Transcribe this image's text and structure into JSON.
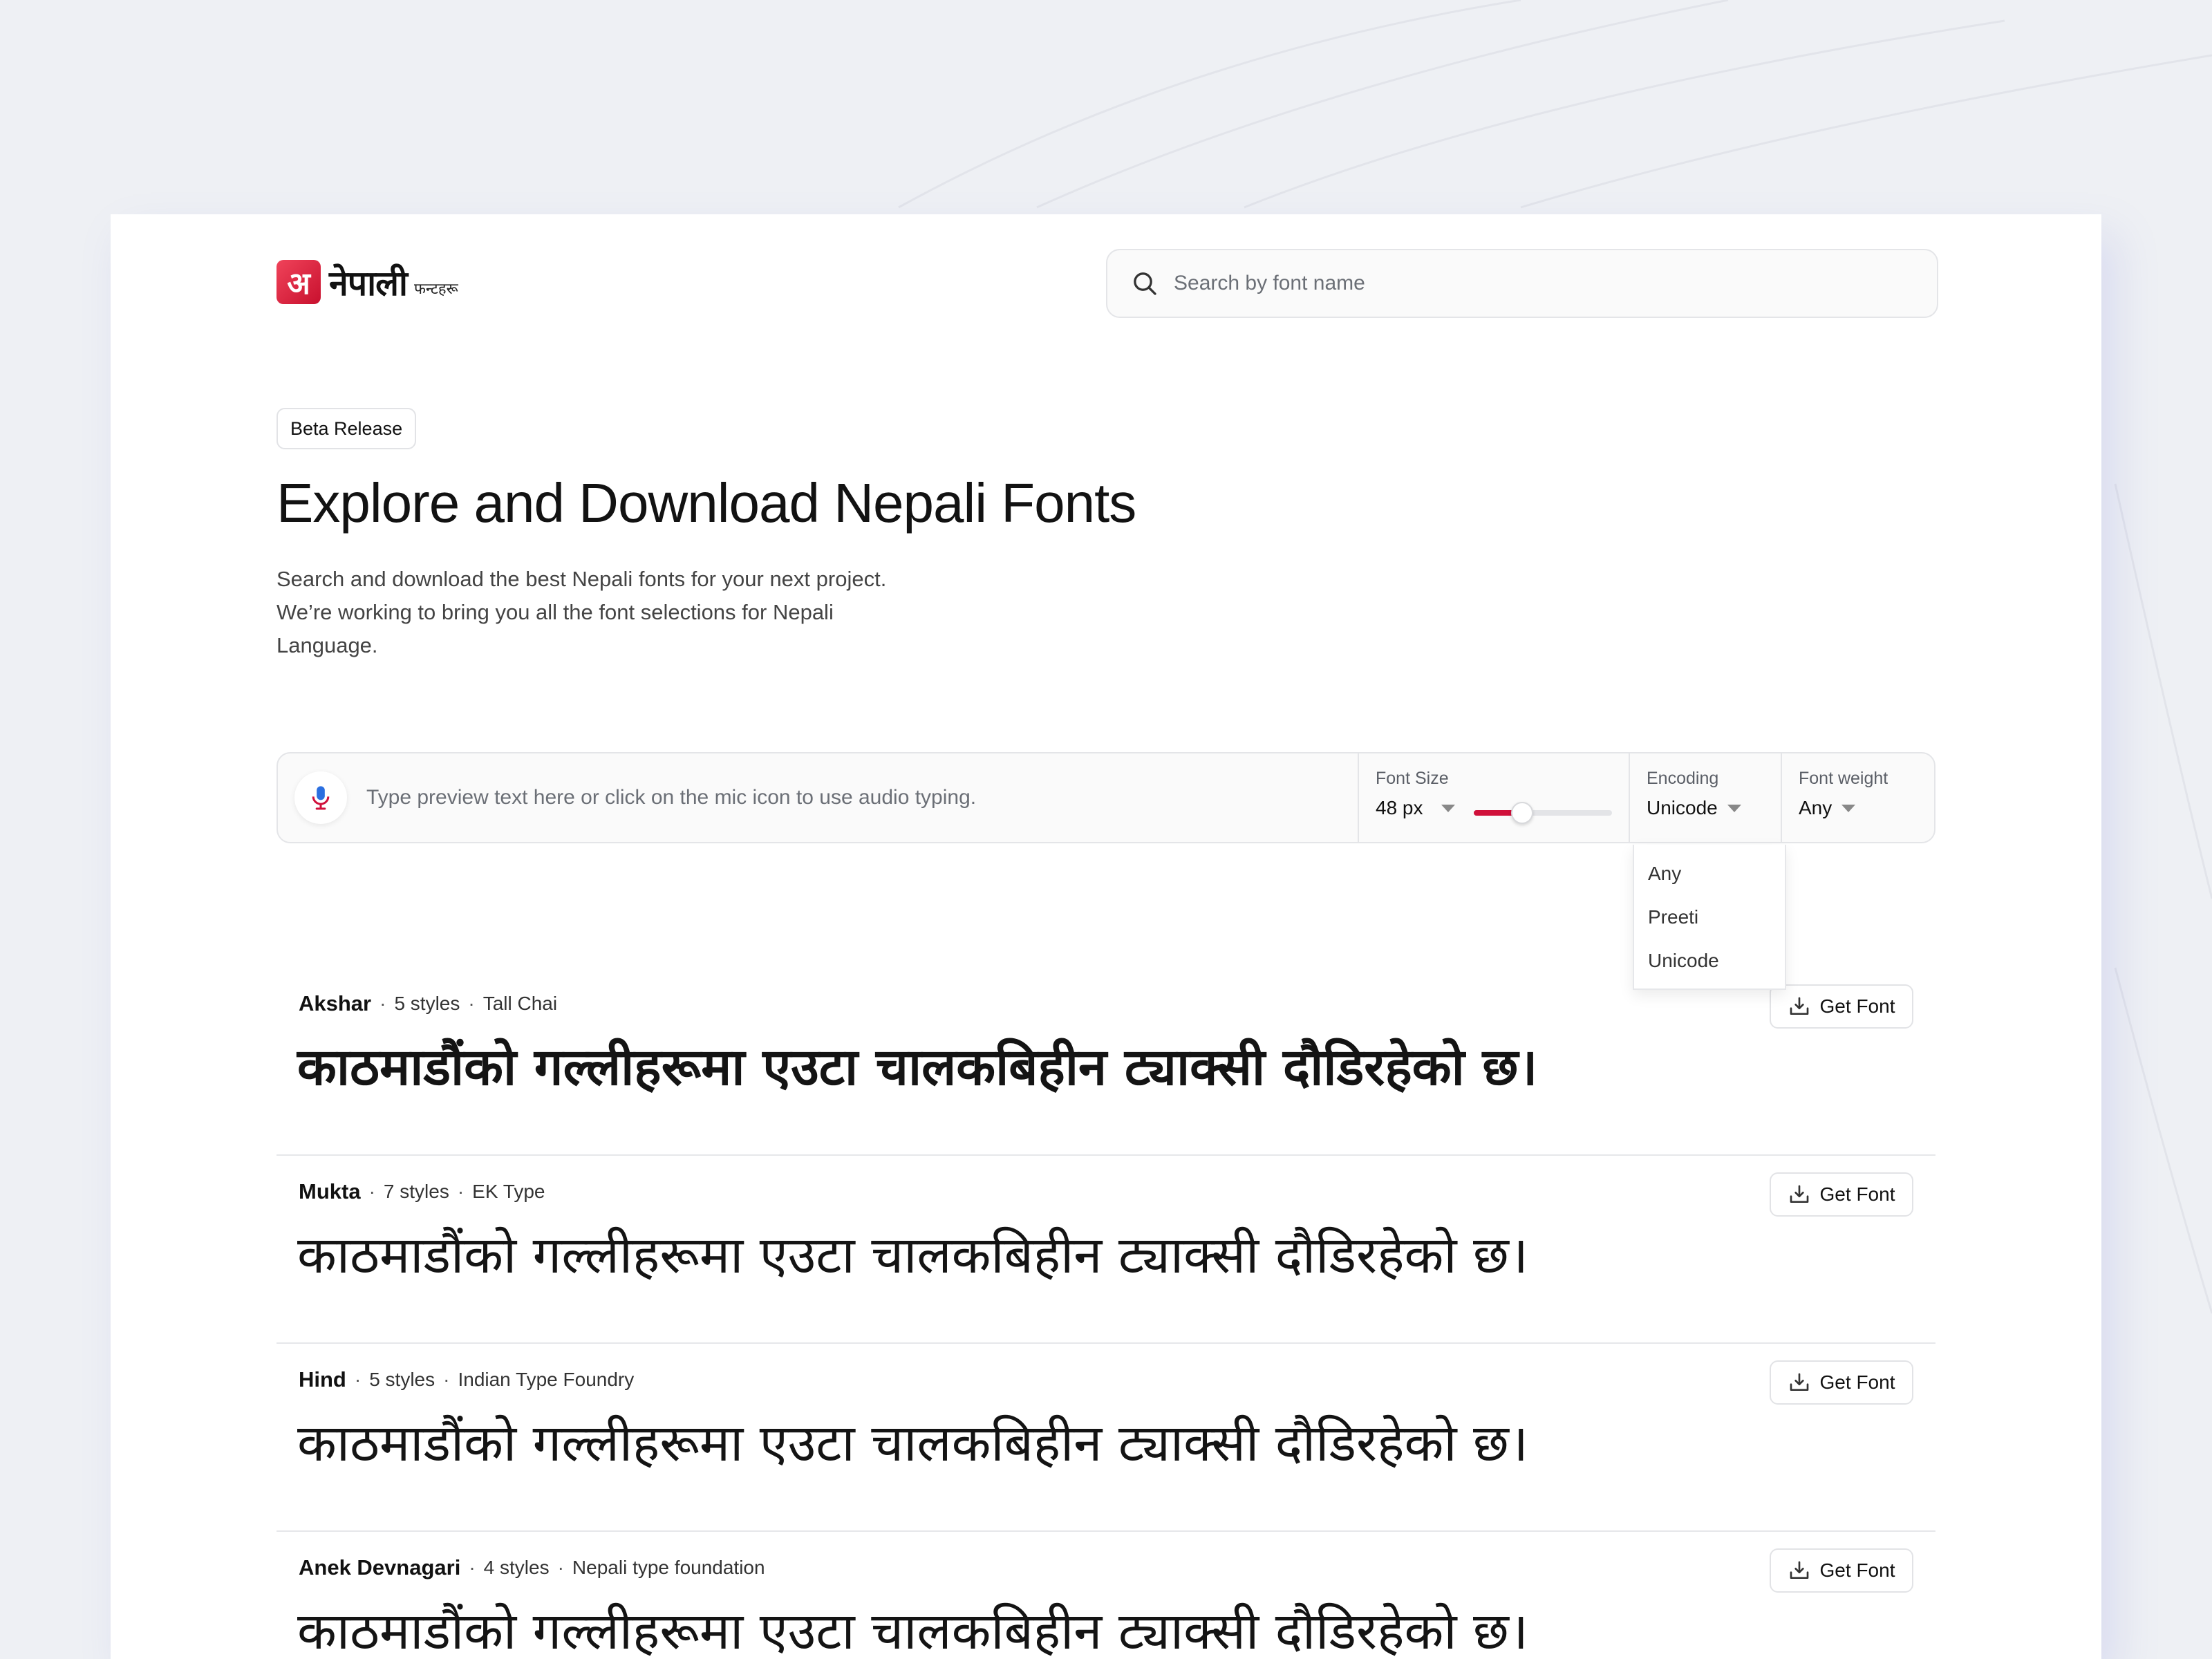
{
  "header": {
    "logo_glyph": "अ",
    "logo_word": "नेपाली",
    "logo_sub": "फन्टहरू",
    "search_placeholder": "Search by font name"
  },
  "hero": {
    "badge": "Beta Release",
    "title": "Explore and Download Nepali Fonts",
    "description": "Search and download the best Nepali fonts for your next project. We’re working to bring you all the font selections for Nepali Language."
  },
  "toolbar": {
    "preview_placeholder": "Type preview text here or click on the mic icon to use audio typing.",
    "font_size_label": "Font Size",
    "font_size_value": "48 px",
    "font_size_slider_fraction": 0.35,
    "encoding_label": "Encoding",
    "encoding_value": "Unicode",
    "encoding_options": [
      "Any",
      "Preeti",
      "Unicode"
    ],
    "weight_label": "Font weight",
    "weight_value": "Any"
  },
  "fonts": [
    {
      "name": "Akshar",
      "styles": "5 styles",
      "foundry": "Tall Chai",
      "sample": "काठमाडौंको गल्लीहरूमा एउटा चालकबिहीन ट्याक्सी दौडिरहेको छ।",
      "button": "Get Font"
    },
    {
      "name": "Mukta",
      "styles": "7 styles",
      "foundry": "EK Type",
      "sample": "काठमाडौंको गल्लीहरूमा एउटा चालकबिहीन ट्याक्सी दौडिरहेको छ।",
      "button": "Get Font"
    },
    {
      "name": "Hind",
      "styles": "5 styles",
      "foundry": "Indian Type Foundry",
      "sample": "काठमाडौंको गल्लीहरूमा एउटा चालकबिहीन ट्याक्सी दौडिरहेको छ।",
      "button": "Get Font"
    },
    {
      "name": "Anek Devnagari",
      "styles": "4 styles",
      "foundry": "Nepali type foundation",
      "sample": "काठमाडौंको गल्लीहरूमा एउटा चालकबिहीन ट्याक्सी दौडिरहेको छ।",
      "button": "Get Font"
    }
  ],
  "colors": {
    "brand": "#d0103a",
    "background": "#eef0f4"
  }
}
